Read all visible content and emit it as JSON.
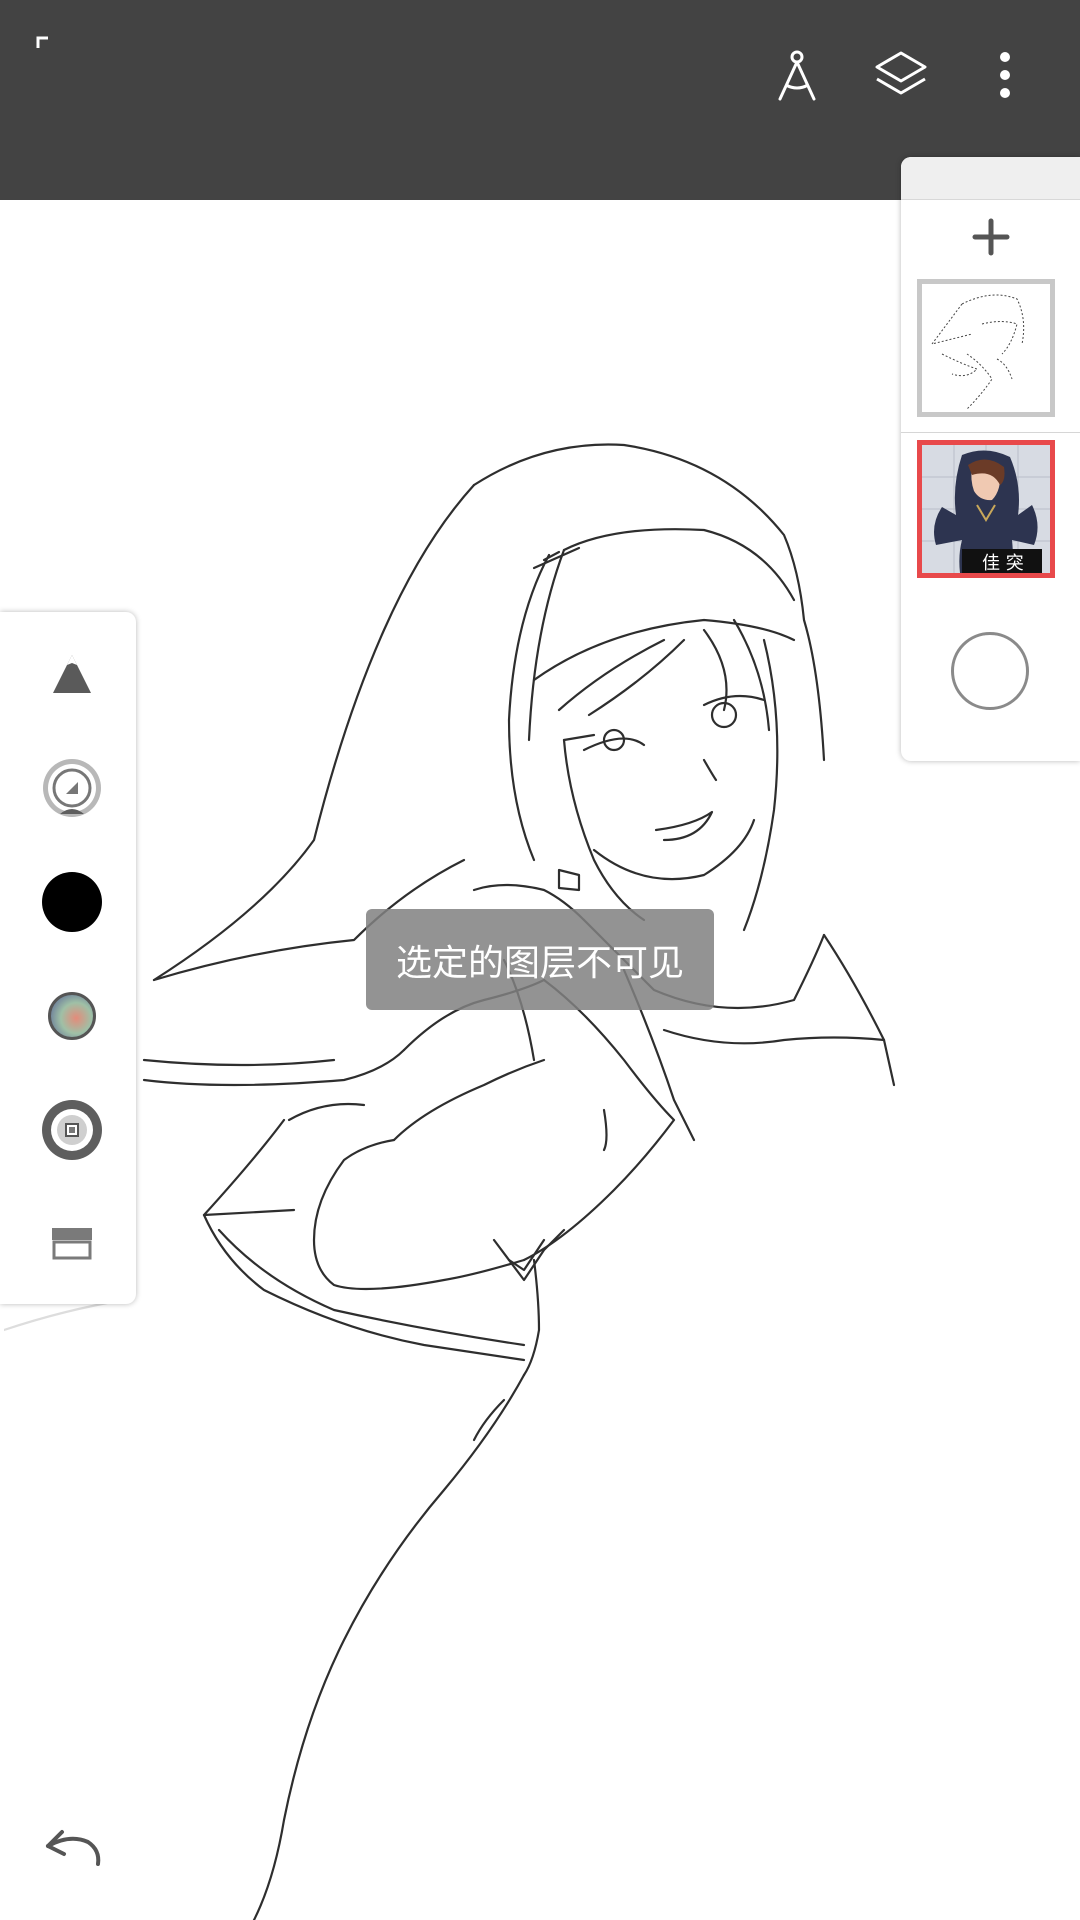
{
  "toolbar": {
    "icons": [
      "corner-bracket-icon",
      "ruler-compass-icon",
      "layers-icon",
      "more-vert-icon"
    ]
  },
  "left_toolbar": {
    "tools": [
      "brush-shape-icon",
      "brush-size-icon",
      "color-swatch-icon",
      "color-picker-icon",
      "opacity-icon",
      "fill-icon"
    ],
    "current_color": "#000000"
  },
  "layers_panel": {
    "add_icon": "plus-icon",
    "layers": [
      {
        "name": "sketch-layer",
        "selected": false
      },
      {
        "name": "reference-layer",
        "selected": true
      }
    ],
    "selected_border_color": "#e8494b"
  },
  "toast": {
    "message": "选定的图层不可见"
  },
  "bottom": {
    "undo_icon": "undo-icon"
  },
  "colors": {
    "topbar": "#434343",
    "canvas": "#ffffff"
  }
}
